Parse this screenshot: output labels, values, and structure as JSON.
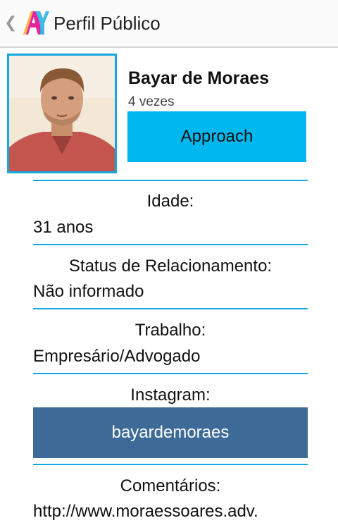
{
  "action_bar": {
    "back_icon": "chevron-left-icon",
    "logo_icon": "app-logo-icon",
    "title": "Perfil Público"
  },
  "profile": {
    "name": "Bayar de Moraes",
    "visits": "4 vezes",
    "approach_label": "Approach",
    "photo_icon": "profile-photo"
  },
  "fields": {
    "age": {
      "label": "Idade:",
      "value": "31 anos"
    },
    "relationship": {
      "label": "Status de Relacionamento:",
      "value": "Não informado"
    },
    "work": {
      "label": "Trabalho:",
      "value": "Empresário/Advogado"
    },
    "instagram": {
      "label": "Instagram:",
      "value": "bayardemoraes"
    },
    "comments": {
      "label": "Comentários:",
      "value": "http://www.moraessoares.adv."
    }
  },
  "colors": {
    "accent": "#12a8e0",
    "approach_button": "#00b7ef",
    "instagram_button": "#3d6a96"
  }
}
